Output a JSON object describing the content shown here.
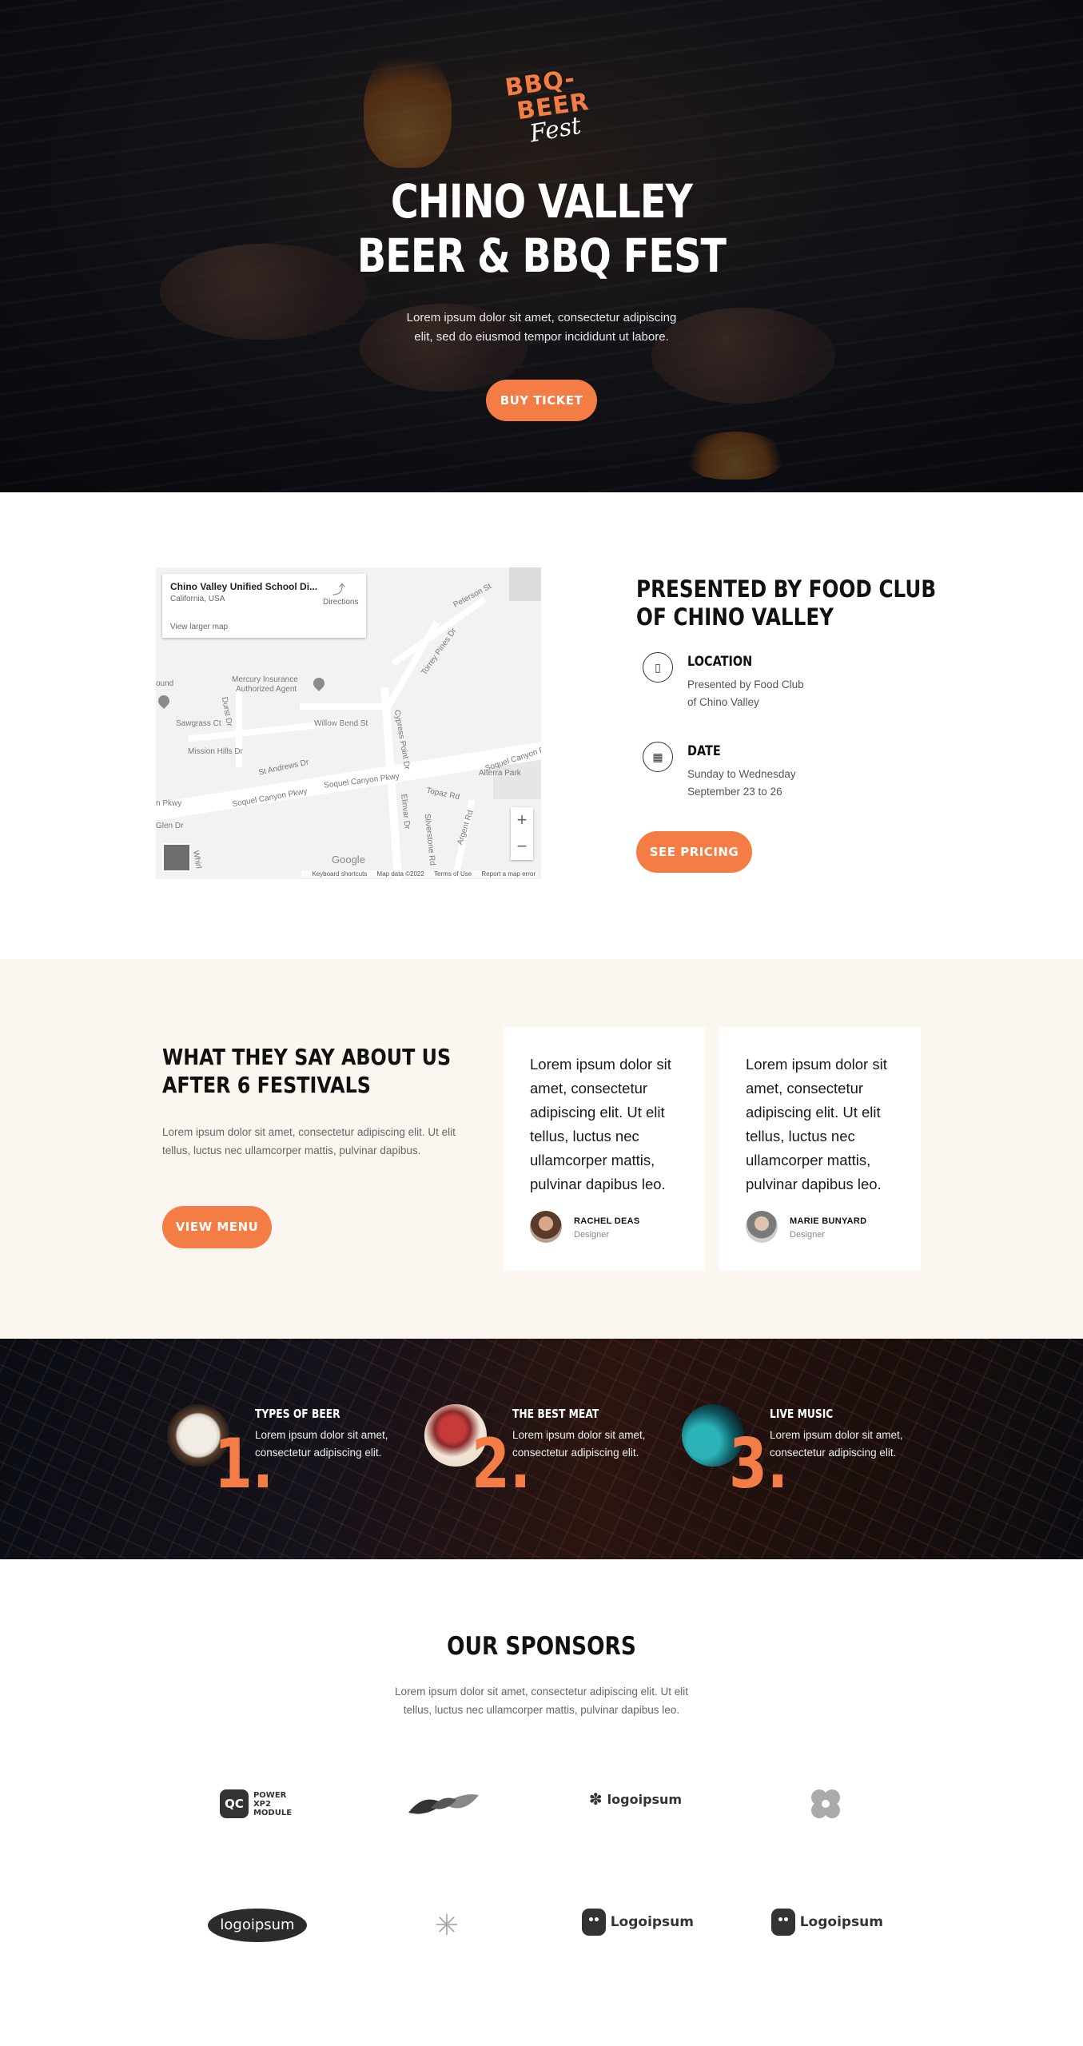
{
  "hero": {
    "logo_line1": "BBQ-",
    "logo_line2": "BEER",
    "logo_line3": "Fest",
    "title_line1": "CHINO VALLEY",
    "title_line2": "BEER & BBQ FEST",
    "subtitle_line1": "Lorem ipsum dolor sit amet, consectetur adipiscing",
    "subtitle_line2": "elit, sed do eiusmod tempor incididunt ut labore.",
    "cta_label": "BUY TICKET",
    "accent_color": "#f47c45"
  },
  "map": {
    "place_title": "Chino Valley Unified School Di...",
    "place_subtitle": "California, USA",
    "view_larger": "View larger map",
    "directions": "Directions",
    "labels": {
      "peterson": "Peterson St",
      "torrey": "Torrey Pines Dr",
      "mercury1": "Mercury Insurance",
      "mercury2": "Authorized Agent",
      "round": "ound",
      "durst": "Durst Dr",
      "sawgrass": "Sawgrass Ct",
      "willow": "Willow Bend St",
      "cypress": "Cypress Point Dr",
      "mission": "Mission Hills Dr",
      "standrews": "St Andrews Dr",
      "soquel_pkwy": "Soquel Canyon Pkwy",
      "soquel_pkwy2": "Soquel Canyon Pkwy",
      "soquel_right": "Soquel Canyon Pkwy",
      "pkwy_left": "n Pkwy",
      "alterra": "Alterra Park",
      "topaz": "Topaz Rd",
      "elinvar": "Elinvar Dr",
      "glen": "Glen Dr",
      "silverstone": "Silverstone Rd",
      "argent": "Argent Rd",
      "whirl": "Whirl"
    },
    "zoom_in": "+",
    "zoom_out": "−",
    "google": "Google",
    "footer_keyboard": "Keyboard shortcuts",
    "footer_data": "Map data ©2022",
    "footer_terms": "Terms of Use",
    "footer_report": "Report a map error"
  },
  "presented": {
    "title_line1": "PRESENTED BY FOOD CLUB",
    "title_line2": "OF CHINO VALLEY",
    "location_icon": "map-icon",
    "location_title": "LOCATION",
    "location_line1": "Presented by Food Club",
    "location_line2": "of Chino Valley",
    "date_icon": "calendar-icon",
    "date_title": "DATE",
    "date_line1": "Sunday to Wednesday",
    "date_line2": "September 23 to 26",
    "cta_label": "SEE PRICING"
  },
  "testimonials": {
    "title_line1": "WHAT THEY SAY ABOUT US",
    "title_line2": "AFTER 6 FESTIVALS",
    "paragraph": "Lorem ipsum dolor sit amet, consectetur adipiscing elit. Ut elit tellus, luctus nec ullamcorper mattis, pulvinar dapibus.",
    "cta_label": "VIEW MENU",
    "cards": [
      {
        "quote": "Lorem ipsum dolor sit amet, consectetur adipiscing elit. Ut elit tellus, luctus nec ullamcorper mattis, pulvinar dapibus leo.",
        "name": "RACHEL DEAS",
        "role": "Designer"
      },
      {
        "quote": "Lorem ipsum dolor sit amet, consectetur adipiscing elit. Ut elit tellus, luctus nec ullamcorper mattis, pulvinar dapibus leo.",
        "name": "MARIE BUNYARD",
        "role": "Designer"
      }
    ]
  },
  "features": [
    {
      "number": "1.",
      "title": "TYPES OF BEER",
      "description": "Lorem ipsum dolor sit amet, consectetur adipiscing elit."
    },
    {
      "number": "2.",
      "title": "THE BEST MEAT",
      "description": "Lorem ipsum dolor sit amet, consectetur adipiscing elit."
    },
    {
      "number": "3.",
      "title": "LIVE MUSIC",
      "description": "Lorem ipsum dolor sit amet, consectetur adipiscing elit."
    }
  ],
  "sponsors": {
    "title": "OUR SPONSORS",
    "subtitle_line1": "Lorem ipsum dolor sit amet, consectetur adipiscing elit. Ut elit",
    "subtitle_line2": "tellus, luctus nec ullamcorper mattis, pulvinar dapibus leo.",
    "logo1_box": "QC",
    "logo1_line1": "POWER",
    "logo1_line2": "XP2",
    "logo1_line3": "MODULE",
    "logo3": "logoipsum",
    "logo5": "logoipsum",
    "logo7": "Logoipsum",
    "logo8": "Logoipsum"
  }
}
